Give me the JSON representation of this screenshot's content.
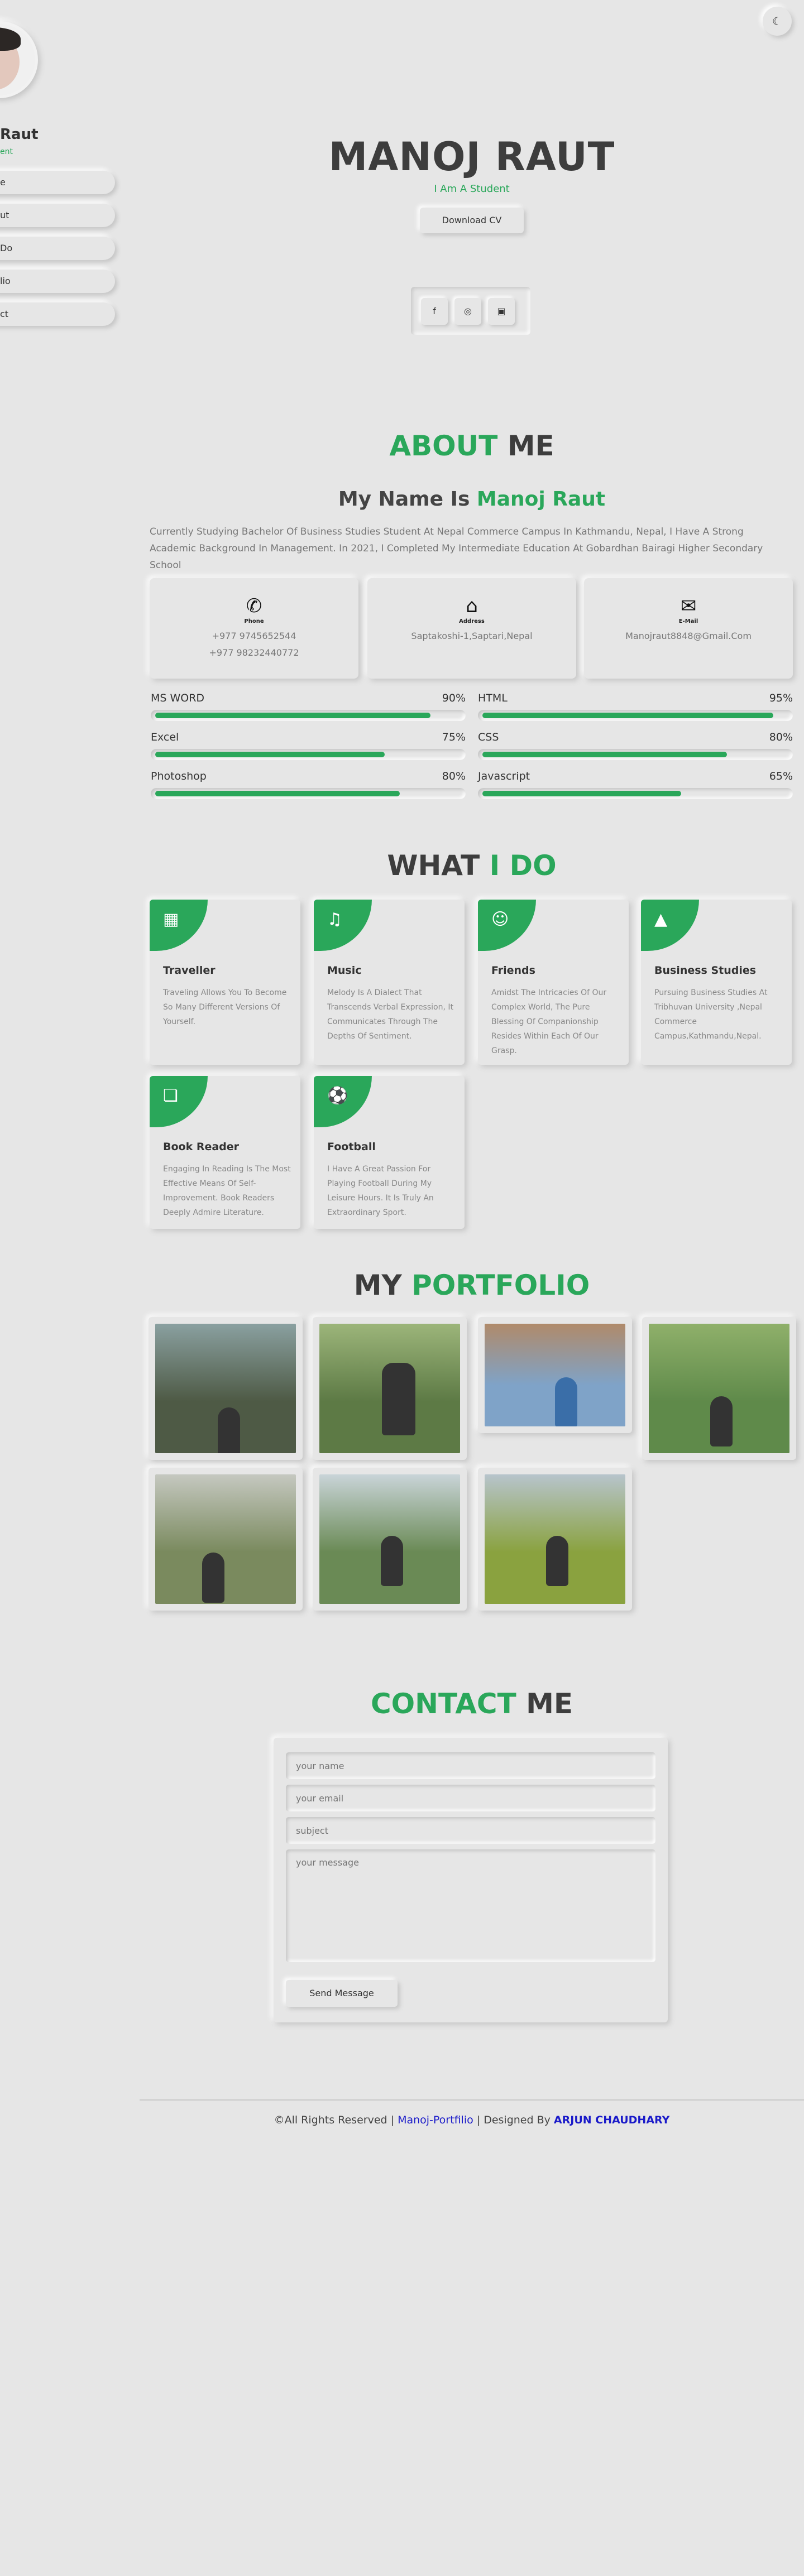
{
  "theme_toggle": {
    "icon": "moon-icon",
    "glyph": "☾"
  },
  "sidebar": {
    "name": "Raut",
    "role": "ent",
    "nav": [
      {
        "label": "e"
      },
      {
        "label": "ut"
      },
      {
        "label": "Do"
      },
      {
        "label": "lio"
      },
      {
        "label": "ct"
      }
    ]
  },
  "hero": {
    "name": "MANOJ RAUT",
    "role": "I Am A Student",
    "download_label": "Download CV",
    "socials": [
      {
        "icon": "facebook-icon",
        "glyph": "f"
      },
      {
        "icon": "instagram-icon",
        "glyph": "◎"
      },
      {
        "icon": "linkedin-icon",
        "glyph": "▣"
      }
    ]
  },
  "about": {
    "title_a": "ABOUT",
    "title_b": " ME",
    "sub_a": "My Name Is ",
    "sub_b": "Manoj Raut",
    "text": "Currently Studying Bachelor Of Business Studies Student At Nepal Commerce Campus In Kathmandu, Nepal, I Have A Strong Academic Background In Management. In 2021, I Completed My Intermediate Education At Gobardhan Bairagi Higher Secondary School",
    "cards": [
      {
        "icon": "phone-icon",
        "glyph": "✆",
        "label": "Phone",
        "line1": "+977 9745652544",
        "line2": "+977 98232440772"
      },
      {
        "icon": "home-icon",
        "glyph": "⌂",
        "label": "Address",
        "line1": "Saptakoshi-1,Saptari,Nepal",
        "line2": ""
      },
      {
        "icon": "mail-icon",
        "glyph": "✉",
        "label": "E-Mail",
        "line1": "Manojraut8848@Gmail.Com",
        "line2": ""
      }
    ],
    "skills": [
      {
        "name": "MS WORD",
        "percent": "90%",
        "value": 90
      },
      {
        "name": "HTML",
        "percent": "95%",
        "value": 95
      },
      {
        "name": "Excel",
        "percent": "75%",
        "value": 75
      },
      {
        "name": "CSS",
        "percent": "80%",
        "value": 80
      },
      {
        "name": "Photoshop",
        "percent": "80%",
        "value": 80
      },
      {
        "name": "Javascript",
        "percent": "65%",
        "value": 65
      }
    ]
  },
  "services": {
    "title_a": "WHAT",
    "title_b": " I DO",
    "items": [
      {
        "icon": "briefcase-icon",
        "glyph": "▦",
        "title": "Traveller",
        "desc": "Traveling Allows You To Become So Many Different Versions Of Yourself."
      },
      {
        "icon": "music-icon",
        "glyph": "♫",
        "title": "Music",
        "desc": "Melody Is A Dialect That Transcends Verbal Expression, It Communicates Through The Depths Of Sentiment."
      },
      {
        "icon": "friends-icon",
        "glyph": "☺",
        "title": "Friends",
        "desc": "Amidst The Intricacies Of Our Complex World, The Pure Blessing Of Companionship Resides Within Each Of Our Grasp."
      },
      {
        "icon": "graduation-cap-icon",
        "glyph": "▲",
        "title": "Business Studies",
        "desc": "Pursuing Business Studies At Tribhuvan University ,Nepal Commerce Campus,Kathmandu,Nepal."
      },
      {
        "icon": "book-reader-icon",
        "glyph": "❏",
        "title": "Book Reader",
        "desc": "Engaging In Reading Is The Most Effective Means Of Self-Improvement. Book Readers Deeply Admire Literature."
      },
      {
        "icon": "football-icon",
        "glyph": "⚽",
        "title": "Football",
        "desc": "I Have A Great Passion For Playing Football During My Leisure Hours. It Is Truly An Extraordinary Sport."
      }
    ]
  },
  "portfolio": {
    "title_a": "MY",
    "title_b": " PORTFOLIO",
    "photos": [
      {
        "name": "waterfall-photo",
        "bg": "#4e5a45",
        "accent": "#8aa0a0"
      },
      {
        "name": "forest-sitting-photo",
        "bg": "#5d7a45",
        "accent": "#9cb57a"
      },
      {
        "name": "temple-photo",
        "bg": "#7fa3c8",
        "accent": "#b08a6a"
      },
      {
        "name": "grass-slope-photo",
        "bg": "#5f8a4a",
        "accent": "#8fb06a"
      },
      {
        "name": "sign-board-photo",
        "bg": "#7a8a5e",
        "accent": "#c5c8c0"
      },
      {
        "name": "trees-sitting-photo",
        "bg": "#6a8a55",
        "accent": "#c9d4d8"
      },
      {
        "name": "hill-view-photo",
        "bg": "#8aa23f",
        "accent": "#b7c4cc"
      }
    ]
  },
  "contact": {
    "title_a": "CONTACT",
    "title_b": " ME",
    "name_placeholder": "your name",
    "email_placeholder": "your email",
    "subject_placeholder": "subject",
    "message_placeholder": "your message",
    "send_label": "Send Message"
  },
  "footer": {
    "prefix": "©All Rights Reserved | ",
    "link": "Manoj-Portfilio",
    "mid": " | Designed By ",
    "author": "ARJUN CHAUDHARY"
  },
  "colors": {
    "accent": "#2aa75a",
    "background": "#e6e6e6",
    "link": "#1a1ac9"
  }
}
